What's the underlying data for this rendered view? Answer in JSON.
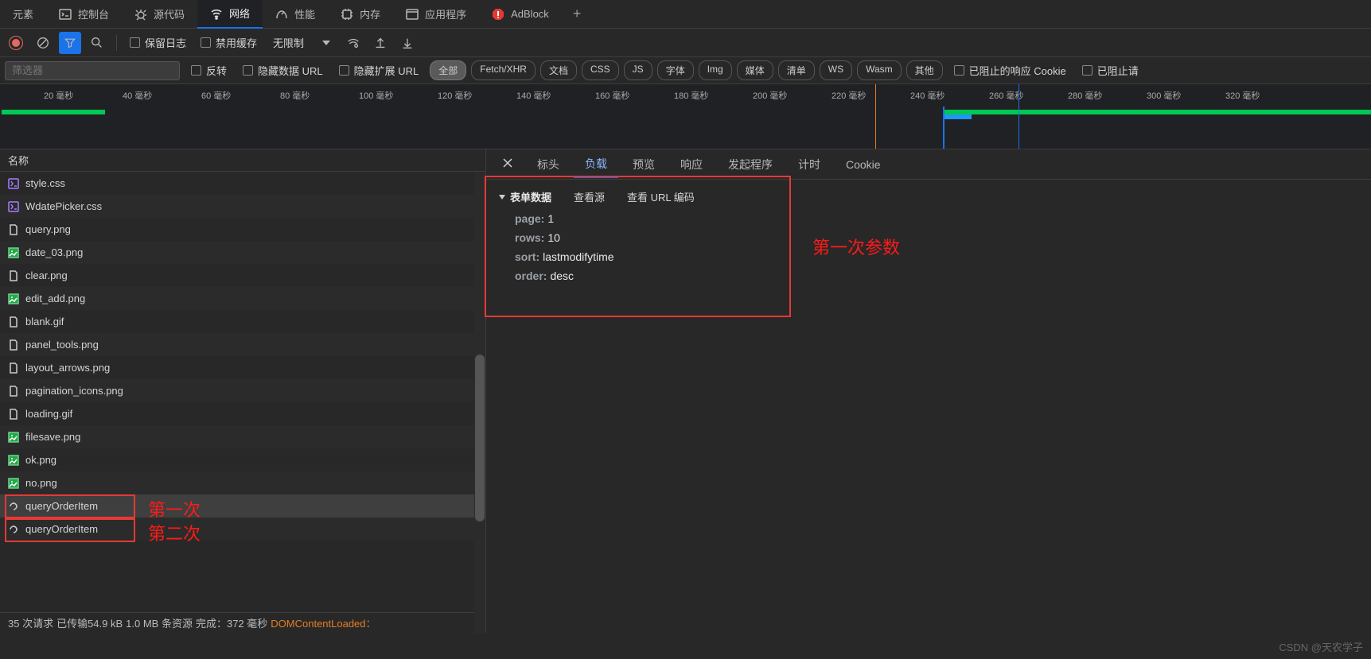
{
  "tabs": {
    "elements": "元素",
    "console": "控制台",
    "sources": "源代码",
    "network": "网络",
    "performance": "性能",
    "memory": "内存",
    "application": "应用程序",
    "adblock": "AdBlock"
  },
  "toolbar": {
    "preserve_log": "保留日志",
    "disable_cache": "禁用缓存",
    "throttling": "无限制"
  },
  "filter": {
    "placeholder": "筛选器",
    "invert": "反转",
    "hide_data_url": "隐藏数据 URL",
    "hide_ext_url": "隐藏扩展 URL",
    "types": [
      "全部",
      "Fetch/XHR",
      "文档",
      "CSS",
      "JS",
      "字体",
      "Img",
      "媒体",
      "清单",
      "WS",
      "Wasm",
      "其他"
    ],
    "blocked_cookie": "已阻止的响应 Cookie",
    "blocked_req": "已阻止请"
  },
  "timeline_ticks": [
    "20 毫秒",
    "40 毫秒",
    "60 毫秒",
    "80 毫秒",
    "100 毫秒",
    "120 毫秒",
    "140 毫秒",
    "160 毫秒",
    "180 毫秒",
    "200 毫秒",
    "220 毫秒",
    "240 毫秒",
    "260 毫秒",
    "280 毫秒",
    "300 毫秒",
    "320 毫秒"
  ],
  "name_header": "名称",
  "requests": [
    {
      "name": "style.css",
      "icon": "css"
    },
    {
      "name": "WdatePicker.css",
      "icon": "css"
    },
    {
      "name": "query.png",
      "icon": "img"
    },
    {
      "name": "date_03.png",
      "icon": "img2"
    },
    {
      "name": "clear.png",
      "icon": "img"
    },
    {
      "name": "edit_add.png",
      "icon": "img2"
    },
    {
      "name": "blank.gif",
      "icon": "img"
    },
    {
      "name": "panel_tools.png",
      "icon": "img"
    },
    {
      "name": "layout_arrows.png",
      "icon": "img"
    },
    {
      "name": "pagination_icons.png",
      "icon": "img"
    },
    {
      "name": "loading.gif",
      "icon": "img"
    },
    {
      "name": "filesave.png",
      "icon": "img2"
    },
    {
      "name": "ok.png",
      "icon": "img2"
    },
    {
      "name": "no.png",
      "icon": "img2"
    },
    {
      "name": "queryOrderItem",
      "icon": "xhr",
      "sel": true
    },
    {
      "name": "queryOrderItem",
      "icon": "xhr"
    }
  ],
  "detail_tabs": {
    "headers": "标头",
    "payload": "负载",
    "preview": "预览",
    "response": "响应",
    "initiator": "发起程序",
    "timing": "计时",
    "cookies": "Cookie"
  },
  "payload": {
    "section": "表单数据",
    "view_source": "查看源",
    "view_url_encoded": "查看 URL 编码",
    "pairs": [
      {
        "k": "page:",
        "v": "1"
      },
      {
        "k": "rows:",
        "v": "10"
      },
      {
        "k": "sort:",
        "v": "lastmodifytime"
      },
      {
        "k": "order:",
        "v": "desc"
      }
    ]
  },
  "annotations": {
    "first": "第一次",
    "second": "第二次",
    "first_params": "第一次参数"
  },
  "status": {
    "requests": "35 次请求",
    "transferred": "已传输54.9 kB",
    "resources": "1.0 MB 条资源",
    "finish": "完成：372  毫秒",
    "dom": "DOMContentLoaded："
  },
  "watermark": "CSDN @天农学子"
}
